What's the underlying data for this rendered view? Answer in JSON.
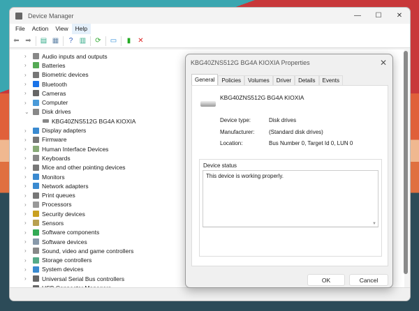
{
  "window": {
    "title": "Device Manager",
    "controls": [
      "—",
      "☐",
      "✕"
    ]
  },
  "menu": [
    {
      "label": "File"
    },
    {
      "label": "Action"
    },
    {
      "label": "View"
    },
    {
      "label": "Help"
    }
  ],
  "toolbar": [
    {
      "icon": "back-icon",
      "glyph": "⬅",
      "color": "#888"
    },
    {
      "icon": "forward-icon",
      "glyph": "➡",
      "color": "#888"
    },
    {
      "icon": "properties-icon",
      "glyph": "▤",
      "color": "#3a8"
    },
    {
      "icon": "update-driver-icon",
      "glyph": "▦",
      "color": "#68a"
    },
    {
      "icon": "help-icon",
      "glyph": "?",
      "color": "#2b5bb8"
    },
    {
      "icon": "view-icon",
      "glyph": "▥",
      "color": "#3a8"
    },
    {
      "icon": "scan-hardware-icon",
      "glyph": "⟳",
      "color": "#3a3"
    },
    {
      "icon": "monitor-icon",
      "glyph": "▭",
      "color": "#2a8ad8"
    },
    {
      "icon": "add-driver-icon",
      "glyph": "▮",
      "color": "#2a2"
    },
    {
      "icon": "uninstall-icon",
      "glyph": "✕",
      "color": "#d22"
    }
  ],
  "tree": [
    {
      "label": "Audio inputs and outputs",
      "color": "#888",
      "arrow": "›"
    },
    {
      "label": "Batteries",
      "color": "#5a5",
      "arrow": "›"
    },
    {
      "label": "Biometric devices",
      "color": "#777",
      "arrow": "›"
    },
    {
      "label": "Bluetooth",
      "color": "#1a73e8",
      "arrow": "›"
    },
    {
      "label": "Cameras",
      "color": "#666",
      "arrow": "›"
    },
    {
      "label": "Computer",
      "color": "#4a9ad8",
      "arrow": "›"
    },
    {
      "label": "Disk drives",
      "color": "#888",
      "arrow": "⌄"
    },
    {
      "label": "KBG40ZNS512G BG4A KIOXIA",
      "child": true
    },
    {
      "label": "Display adapters",
      "color": "#3a8ad0",
      "arrow": "›"
    },
    {
      "label": "Firmware",
      "color": "#777",
      "arrow": "›"
    },
    {
      "label": "Human Interface Devices",
      "color": "#8a7",
      "arrow": "›"
    },
    {
      "label": "Keyboards",
      "color": "#888",
      "arrow": "›"
    },
    {
      "label": "Mice and other pointing devices",
      "color": "#777",
      "arrow": "›"
    },
    {
      "label": "Monitors",
      "color": "#3a8ad0",
      "arrow": "›"
    },
    {
      "label": "Network adapters",
      "color": "#3a8ad0",
      "arrow": "›"
    },
    {
      "label": "Print queues",
      "color": "#777",
      "arrow": "›"
    },
    {
      "label": "Processors",
      "color": "#999",
      "arrow": "›"
    },
    {
      "label": "Security devices",
      "color": "#c9a020",
      "arrow": "›"
    },
    {
      "label": "Sensors",
      "color": "#b8a050",
      "arrow": "›"
    },
    {
      "label": "Software components",
      "color": "#3a5",
      "arrow": "›"
    },
    {
      "label": "Software devices",
      "color": "#89a",
      "arrow": "›"
    },
    {
      "label": "Sound, video and game controllers",
      "color": "#888",
      "arrow": "›"
    },
    {
      "label": "Storage controllers",
      "color": "#5a8",
      "arrow": "›"
    },
    {
      "label": "System devices",
      "color": "#3a8ad0",
      "arrow": "›"
    },
    {
      "label": "Universal Serial Bus controllers",
      "color": "#666",
      "arrow": "›"
    },
    {
      "label": "USB Connector Managers",
      "color": "#666",
      "arrow": "›"
    }
  ],
  "dialog": {
    "title": "KBG40ZNS512G BG4A KIOXIA Properties",
    "close": "✕",
    "tabs": [
      "General",
      "Policies",
      "Volumes",
      "Driver",
      "Details",
      "Events"
    ],
    "device_name": "KBG40ZNS512G BG4A KIOXIA",
    "fields": [
      {
        "label": "Device type:",
        "value": "Disk drives"
      },
      {
        "label": "Manufacturer:",
        "value": "(Standard disk drives)"
      },
      {
        "label": "Location:",
        "value": "Bus Number 0, Target Id 0, LUN 0"
      }
    ],
    "status_label": "Device status",
    "status_text": "This device is working properly.",
    "ok": "OK",
    "cancel": "Cancel"
  }
}
